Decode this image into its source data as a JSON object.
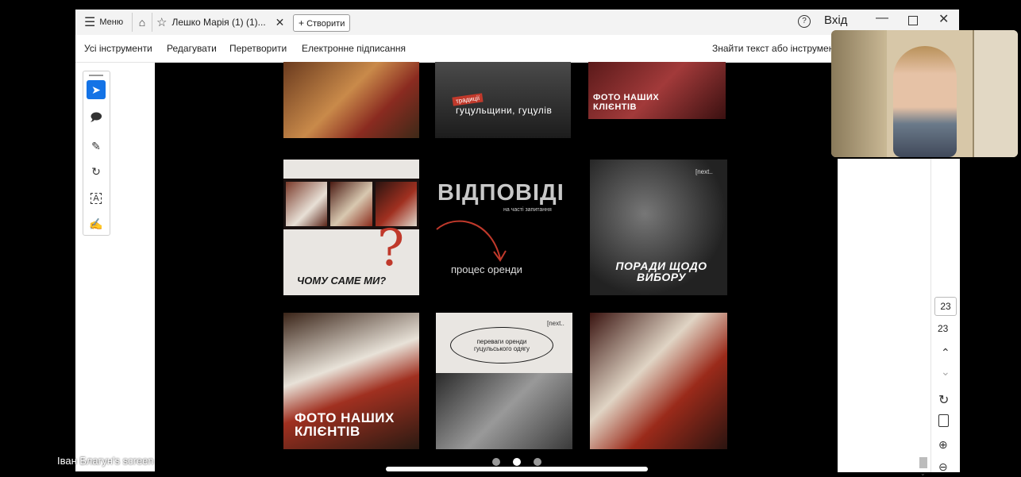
{
  "browser": {
    "menu_label": "Меню",
    "tab_title": "Лешко Марія (1) (1)...",
    "create_label": "Створити",
    "login_label": "Вхід"
  },
  "toolbar": {
    "items": [
      "Усі інструменти",
      "Редагувати",
      "Перетворити",
      "Електронне підписання"
    ],
    "search_label": "Знайти текст або інструмент"
  },
  "posts": {
    "p3_caption": "Фото наших клієнтів",
    "p2_badge": "традиції",
    "p2_caption": "гуцульщини, гуцулів",
    "p4_caption": "Чому саме ми?",
    "p5_title": "ВІДПОВІДІ",
    "p5_sub": "на часті запитання",
    "p5_process": "процес оренди",
    "p6_next": "[next..",
    "p6_caption": "Поради щодо вибору",
    "p7_caption": "Фото наших клієнтів",
    "p8_next": "[next..",
    "p8_oval": "переваги оренди гуцульського одягу"
  },
  "page_nav": {
    "page_input": "23",
    "total_pages": "23"
  },
  "screen_share": {
    "label": "Іван Благун's screen"
  },
  "carousel": {
    "count": 3,
    "active_index": 1
  }
}
